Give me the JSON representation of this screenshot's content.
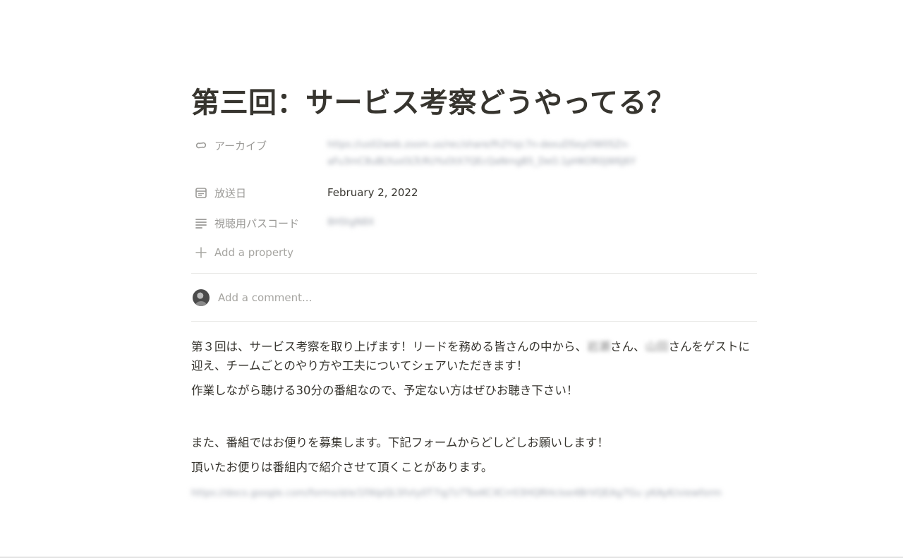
{
  "page": {
    "title": "第三回：サービス考察どうやってる？"
  },
  "properties": [
    {
      "icon": "link-icon",
      "label": "アーカイブ",
      "value_line1": "https://us02web.zoom.us/rec/share/fh2Yxjc7n-dexuDSeyOW0SZn-",
      "value_line2": "aFu3mC8uBLYuoOLTcRUYuOtX7QEcQaNmgB5_DeO.1pHKOR0jW6J6Y"
    },
    {
      "icon": "calendar-icon",
      "label": "放送日",
      "value": "February 2, 2022"
    },
    {
      "icon": "text-lines-icon",
      "label": "視聴用パスコード",
      "value": "8HStgN8X"
    }
  ],
  "add_property_label": "Add a property",
  "comment_placeholder": "Add a comment...",
  "body": {
    "p1_part1": "第３回は、サービス考察を取り上げます！リードを務める皆さんの中から、",
    "p1_name1": "岩瀬",
    "p1_part2": "さん、",
    "p1_name2": "山田",
    "p1_part3": "さんをゲストに迎え、チームごとのやり方や工夫についてシェアいただきます！",
    "p2": "作業しながら聴ける30分の番組なので、予定ない方はぜひお聴き下さい！",
    "p3": "また、番組ではお便りを募集します。下記フォームからどしどしお願いします！",
    "p4": "頂いたお便りは番組内で紹介させて頂くことがあります。",
    "form_link": "https://docs.google.com/forms/d/e/1FAIpQLSfvty0T7ig7z7ToxKCXCrr03HQRHcIoe4BrVQEAg7Gu yKAyK/viewform"
  }
}
